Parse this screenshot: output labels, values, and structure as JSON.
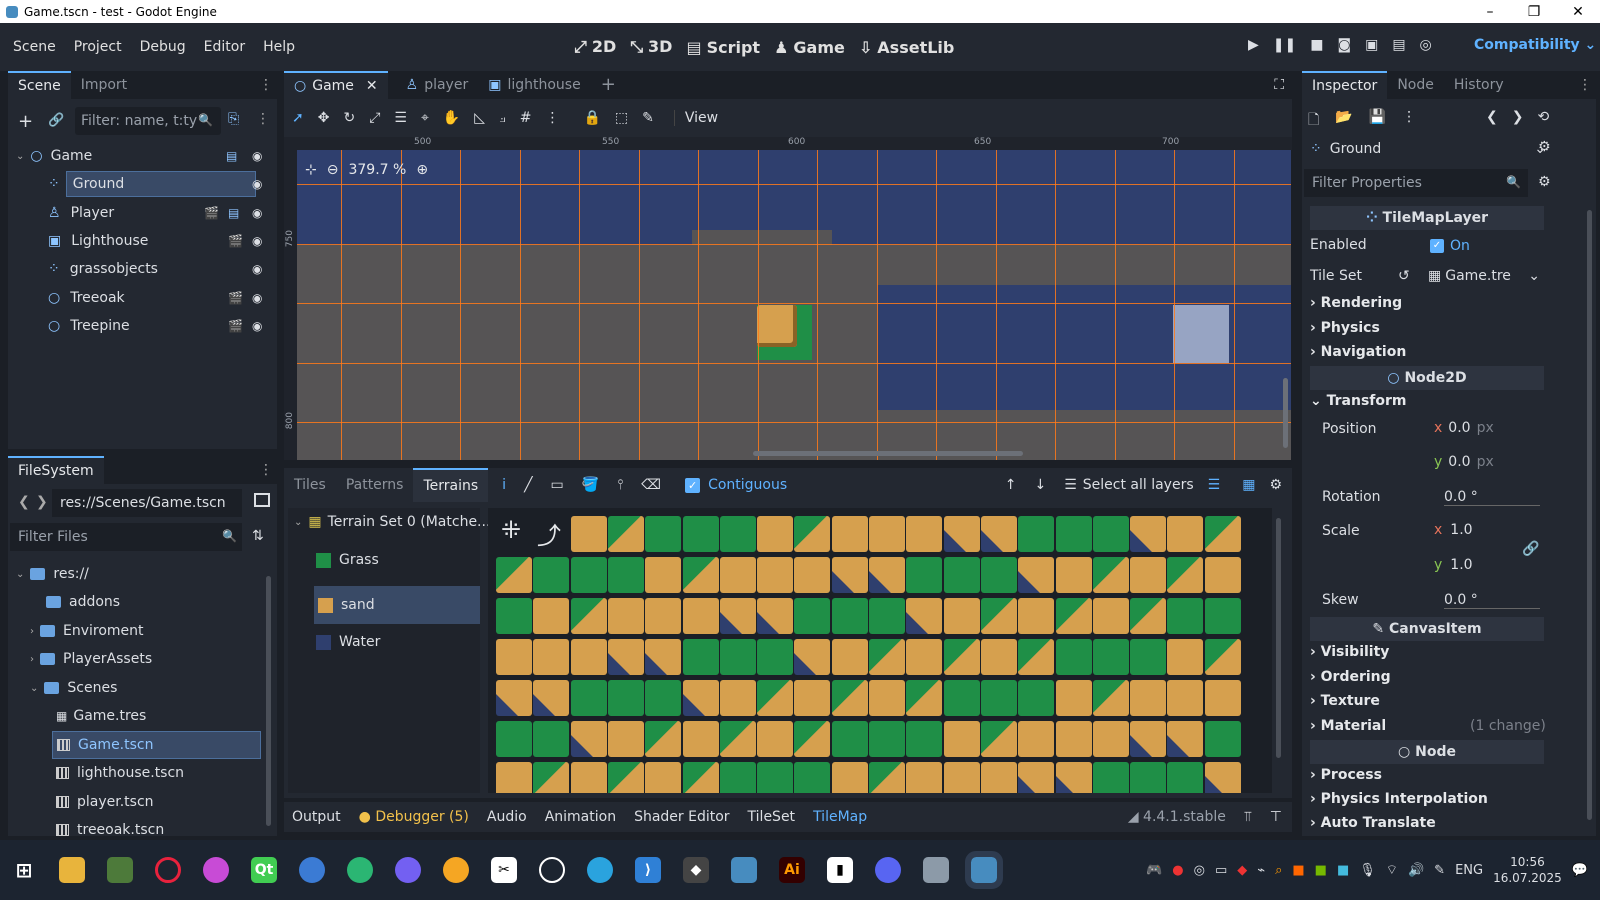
{
  "window": {
    "title": "Game.tscn - test - Godot Engine"
  },
  "menu": [
    "Scene",
    "Project",
    "Debug",
    "Editor",
    "Help"
  ],
  "workspaces": [
    {
      "label": "2D",
      "icon": "2d-icon",
      "active": true
    },
    {
      "label": "3D",
      "icon": "3d-icon",
      "active": false
    },
    {
      "label": "Script",
      "icon": "script-icon",
      "active": false
    },
    {
      "label": "Game",
      "icon": "game-icon",
      "active": false
    },
    {
      "label": "AssetLib",
      "icon": "assetlib-icon",
      "active": false
    }
  ],
  "renderer": "Compatibility",
  "scene_dock": {
    "tabs": [
      "Scene",
      "Import"
    ],
    "filter_placeholder": "Filter: name, t:ty",
    "nodes": [
      {
        "name": "Game",
        "icon": "node2d-icon",
        "level": 0,
        "selected": false
      },
      {
        "name": "Ground",
        "icon": "tilemaplayer-icon",
        "level": 1,
        "selected": true
      },
      {
        "name": "Player",
        "icon": "characterbody-icon",
        "level": 1,
        "selected": false
      },
      {
        "name": "Lighthouse",
        "icon": "staticbody-icon",
        "level": 1,
        "selected": false
      },
      {
        "name": "grassobjects",
        "icon": "tilemaplayer-icon",
        "level": 1,
        "selected": false
      },
      {
        "name": "Treeoak",
        "icon": "node2d-icon",
        "level": 1,
        "selected": false
      },
      {
        "name": "Treepine",
        "icon": "node2d-icon",
        "level": 1,
        "selected": false
      }
    ]
  },
  "filesystem": {
    "title": "FileSystem",
    "path": "res://Scenes/Game.tscn",
    "filter_placeholder": "Filter Files",
    "items": [
      {
        "name": "res://",
        "type": "folder",
        "level": 0,
        "expanded": true,
        "selected": false
      },
      {
        "name": "addons",
        "type": "folder",
        "level": 1,
        "expanded": false,
        "selected": false
      },
      {
        "name": "Enviroment",
        "type": "folder",
        "level": 1,
        "expanded": false,
        "selected": false
      },
      {
        "name": "PlayerAssets",
        "type": "folder",
        "level": 1,
        "expanded": false,
        "selected": false
      },
      {
        "name": "Scenes",
        "type": "folder",
        "level": 1,
        "expanded": true,
        "selected": false
      },
      {
        "name": "Game.tres",
        "type": "tres",
        "level": 2,
        "expanded": false,
        "selected": false
      },
      {
        "name": "Game.tscn",
        "type": "tscn",
        "level": 2,
        "expanded": false,
        "selected": true
      },
      {
        "name": "lighthouse.tscn",
        "type": "tscn",
        "level": 2,
        "expanded": false,
        "selected": false
      },
      {
        "name": "player.tscn",
        "type": "tscn",
        "level": 2,
        "expanded": false,
        "selected": false
      },
      {
        "name": "treeoak.tscn",
        "type": "tscn",
        "level": 2,
        "expanded": false,
        "selected": false
      }
    ]
  },
  "editor_tabs": [
    {
      "label": "Game",
      "active": true
    },
    {
      "label": "player",
      "active": false
    },
    {
      "label": "lighthouse",
      "active": false
    }
  ],
  "toolbar": {
    "view_label": "View"
  },
  "viewport": {
    "zoom": "379.7 %",
    "ruler_h": [
      "500",
      "550",
      "600",
      "650",
      "700"
    ],
    "ruler_v": [
      "750",
      "800"
    ]
  },
  "tilemap_panel": {
    "tabs": [
      "Tiles",
      "Patterns",
      "Terrains"
    ],
    "active_tab": "Terrains",
    "contiguous_label": "Contiguous",
    "contiguous_checked": true,
    "select_layers_label": "Select all layers",
    "terrain_set": "Terrain Set 0 (Matche...",
    "terrains": [
      {
        "name": "Grass",
        "color": "#1f8f47",
        "selected": false
      },
      {
        "name": "sand",
        "color": "#d6a04e",
        "selected": true
      },
      {
        "name": "Water",
        "color": "#2f3f6e",
        "selected": false
      }
    ]
  },
  "bottom_bar": {
    "tabs": [
      "Output",
      "Debugger (5)",
      "Audio",
      "Animation",
      "Shader Editor",
      "TileSet",
      "TileMap"
    ],
    "active_tab": "TileMap",
    "version": "4.4.1.stable"
  },
  "inspector": {
    "tabs": [
      "Inspector",
      "Node",
      "History"
    ],
    "object_name": "Ground",
    "filter_placeholder": "Filter Properties",
    "class_tilemaplayer": "TileMapLayer",
    "enabled_label": "Enabled",
    "enabled_value": "On",
    "tileset_label": "Tile Set",
    "tileset_value": "Game.tre",
    "sections_a": [
      "Rendering",
      "Physics",
      "Navigation"
    ],
    "class_node2d": "Node2D",
    "transform_label": "Transform",
    "position_label": "Position",
    "position_x": "0.0",
    "position_y": "0.0",
    "unit_px": "px",
    "rotation_label": "Rotation",
    "rotation_value": "0.0 °",
    "scale_label": "Scale",
    "scale_x": "1.0",
    "scale_y": "1.0",
    "skew_label": "Skew",
    "skew_value": "0.0 °",
    "class_canvasitem": "CanvasItem",
    "sections_b": [
      "Visibility",
      "Ordering",
      "Texture",
      "Material"
    ],
    "material_note": "(1 change)",
    "class_node": "Node",
    "sections_c": [
      "Process",
      "Physics Interpolation",
      "Auto Translate"
    ]
  },
  "taskbar": {
    "lang": "ENG",
    "time": "10:56",
    "date": "16.07.2025"
  },
  "colors": {
    "accent": "#5fb2ff",
    "grass": "#1f8f47",
    "sand": "#d6a04e",
    "water": "#2f3f6e",
    "grid": "#ff7a1a"
  }
}
